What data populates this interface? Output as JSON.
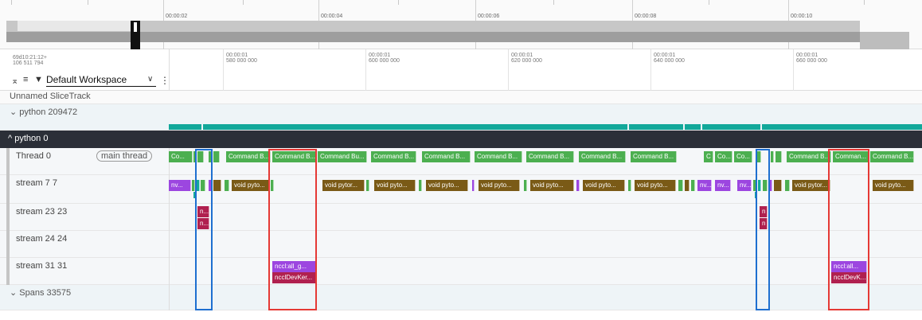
{
  "overview": {
    "tick_labels": [
      "00:00:02",
      "00:00:04",
      "00:00:06",
      "00:00:08",
      "00:00:10"
    ]
  },
  "workspace": {
    "timestamp_line1": "69d10:21:12+",
    "timestamp_line2": "106 511 794",
    "name": "Default Workspace",
    "chevron": "∨",
    "menu": "⋮"
  },
  "ruler": {
    "ticks": [
      {
        "l1": "00:00:01",
        "l2": "580 000 000"
      },
      {
        "l1": "00:00:01",
        "l2": "600 000 000"
      },
      {
        "l1": "00:00:01",
        "l2": "620 000 000"
      },
      {
        "l1": "00:00:01",
        "l2": "640 000 000"
      },
      {
        "l1": "00:00:01",
        "l2": "660 000 000"
      }
    ]
  },
  "tracks": {
    "unnamed": "Unnamed SliceTrack",
    "python_group": "python 209472",
    "python0": "python 0",
    "thread0": "Thread 0",
    "main_thread": "main thread",
    "stream7": "stream 7 7",
    "stream23": "stream 23 23",
    "stream24": "stream 24 24",
    "stream31": "stream 31 31",
    "spans": "Spans 33575"
  },
  "slices": {
    "thread0": [
      "Co...",
      "Command B...",
      "Command B...",
      "Command Bu...",
      "Command B...",
      "Command B...",
      "Command B...",
      "Command B...",
      "Command B...",
      "Command B...",
      "C",
      "Co...",
      "Co...",
      "Command B...",
      "Comman...",
      "Command B..."
    ],
    "stream7": [
      "nv...",
      "void pyto...",
      "void pytor...",
      "void pyto...",
      "void pyto...",
      "void pyto...",
      "void pyto...",
      "void pyto...",
      "void pyto...",
      "nv...",
      "nv...",
      "nv...",
      "void pytor...",
      "void pyto..."
    ],
    "stream23": [
      "n...",
      "n...",
      "n",
      "n"
    ],
    "stream31": [
      "nccl:all_g...",
      "ncclDevKer...",
      "nccl:all...",
      "ncclDevK..."
    ]
  },
  "colors": {
    "thread_green": "#4caf50",
    "stream_olive": "#7a5a16",
    "purple": "#9c46e0",
    "maroon": "#b0204f",
    "teal": "#12a89a",
    "dark_header": "#2b2f38",
    "highlight_red": "#e53935",
    "highlight_blue": "#1e6fd0"
  }
}
